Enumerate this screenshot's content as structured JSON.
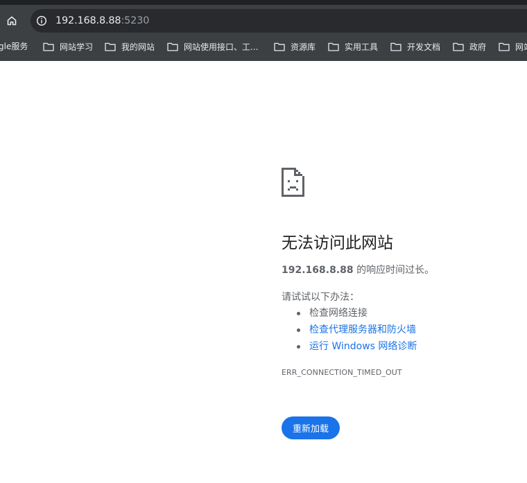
{
  "browser": {
    "url_host": "192.168.8.88",
    "url_port": ":5230",
    "bookmarks": [
      "gle服务",
      "网站学习",
      "我的网站",
      "网站使用接口、工...",
      "资源库",
      "实用工具",
      "开发文档",
      "政府",
      "网站"
    ]
  },
  "error_page": {
    "title": "无法访问此网站",
    "host": "192.168.8.88",
    "desc_suffix": " 的响应时间过长。",
    "try_label": "请试试以下办法：",
    "suggestions": [
      "检查网络连接",
      "检查代理服务器和防火墙",
      "运行 Windows 网络诊断"
    ],
    "error_code": "ERR_CONNECTION_TIMED_OUT",
    "reload_label": "重新加载"
  },
  "colors": {
    "toolbar_bg": "#3c4043",
    "omnibox_bg": "#282a2d",
    "link": "#1a73e8",
    "button_bg": "#1a73e8",
    "body_text": "#5f6368"
  },
  "icons": [
    "home-icon",
    "info-icon",
    "folder-icon",
    "sad-page-icon"
  ]
}
